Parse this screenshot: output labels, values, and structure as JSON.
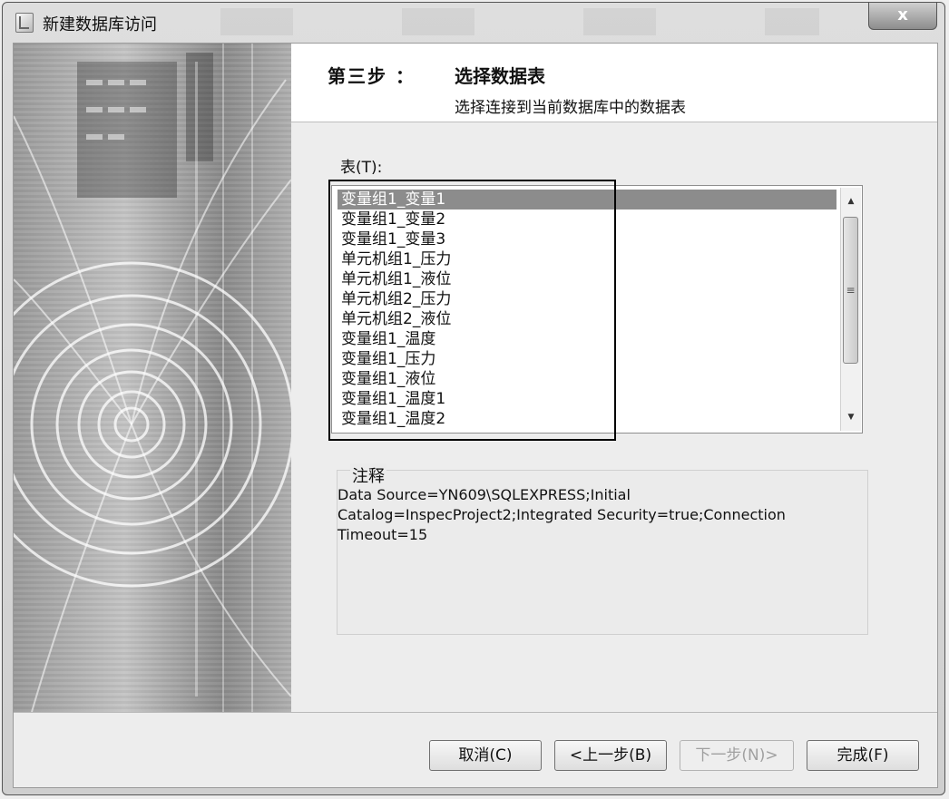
{
  "window": {
    "title": "新建数据库访问",
    "close_label": "x"
  },
  "header": {
    "step_label": "第三步 ：",
    "step_title": "选择数据表",
    "step_description": "选择连接到当前数据库中的数据表"
  },
  "table_list": {
    "label": "表(T):",
    "items": [
      "变量组1_变量1",
      "变量组1_变量2",
      "变量组1_变量3",
      "单元机组1_压力",
      "单元机组1_液位",
      "单元机组2_压力",
      "单元机组2_液位",
      "变量组1_温度",
      "变量组1_压力",
      "变量组1_液位",
      "变量组1_温度1",
      "变量组1_温度2"
    ],
    "selected_index": 0
  },
  "notes": {
    "title": "注释",
    "text": "Data Source=YN609\\SQLEXPRESS;Initial Catalog=InspecProject2;Integrated Security=true;Connection Timeout=15"
  },
  "buttons": {
    "cancel": "取消(C)",
    "prev": "<上一步(B)",
    "next": "下一步(N)>",
    "finish": "完成(F)"
  },
  "colors": {
    "selected_bg": "#8c8c8c",
    "highlight_border": "#000000"
  }
}
